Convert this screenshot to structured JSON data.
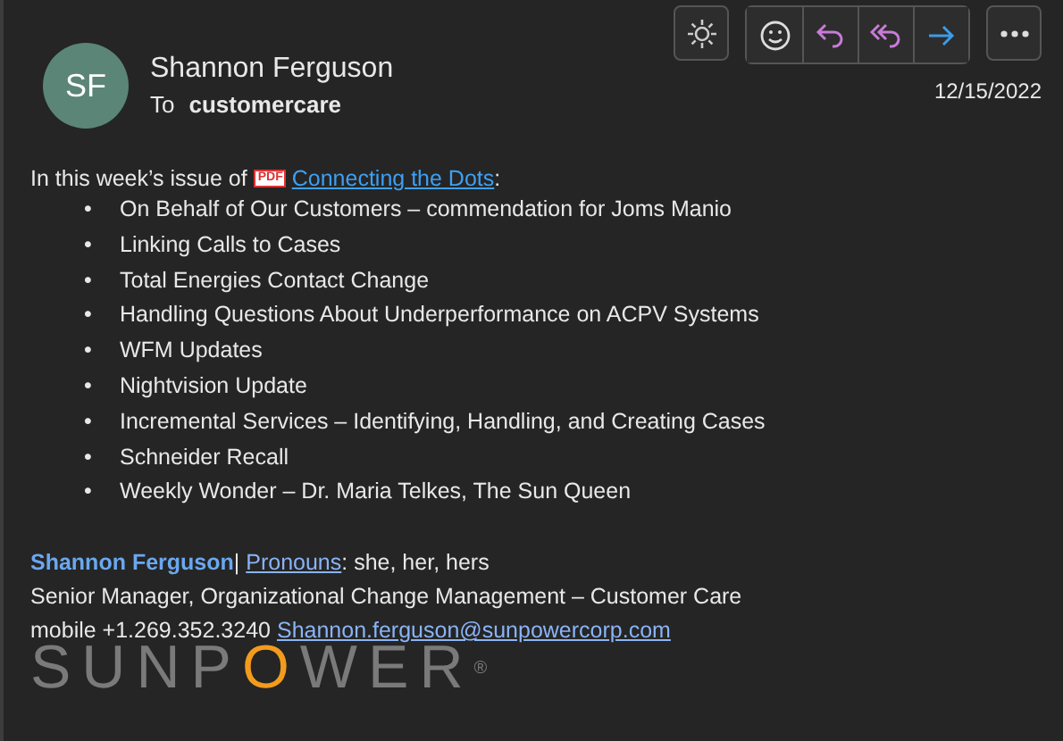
{
  "header": {
    "avatar_initials": "SF",
    "sender": "Shannon Ferguson",
    "to_label": "To",
    "recipient": "customercare",
    "date": "12/15/2022"
  },
  "toolbar": {
    "groups": [
      [
        {
          "kind": "sun"
        }
      ],
      [
        {
          "kind": "emoji"
        },
        {
          "kind": "reply"
        },
        {
          "kind": "reply_all"
        },
        {
          "kind": "forward"
        }
      ],
      [
        {
          "kind": "more"
        }
      ]
    ]
  },
  "body": {
    "intro": "In this week’s issue of",
    "attachment_badge": "PDF",
    "link": "Connecting the Dots",
    "intro_end": ":",
    "bullet_marker": "•",
    "bullets": [
      "On Behalf of Our Customers – commendation for Joms Manio",
      "Linking Calls to Cases",
      "Total Energies Contact Change",
      "Handling Questions About Underperformance on ACPV Systems",
      "WFM Updates",
      "Nightvision Update",
      "Incremental Services – Identifying, Handling, and Creating Cases",
      "Schneider Recall",
      "Weekly Wonder – Dr. Maria Telkes, The Sun Queen"
    ]
  },
  "signature": {
    "name": "Shannon Ferguson",
    "separator": "|",
    "pronouns_link": "Pronouns",
    "pronouns": ": she, her, hers",
    "title": "Senior Manager, Organizational Change Management – Customer Care",
    "mobile": "mobile +1.269.352.3240",
    "email": "Shannon.ferguson@sunpowercorp.com",
    "logo_parts": [
      "SUNP",
      "O",
      "WER"
    ],
    "logo_mark": "®"
  }
}
